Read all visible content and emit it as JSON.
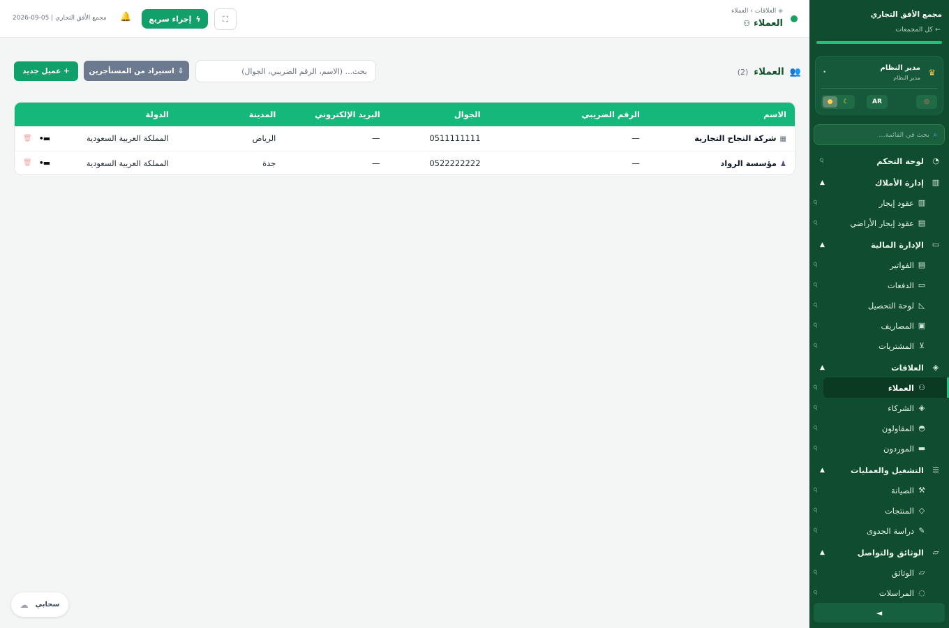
{
  "sidebar": {
    "brand_title": "مجمع الأفق التجاري",
    "brand_back": "← كل المجمعات",
    "user": {
      "name": "مدير النظام",
      "role": "مدير النظام",
      "dot": "•"
    },
    "lang_label": "AR",
    "search_placeholder": "بحث في القائمة...",
    "collapse_icon": "◄",
    "items": [
      {
        "label": "لوحة التحكم",
        "icon": "dashboard-icon",
        "glyph": "◔",
        "level": "top",
        "caret": ""
      },
      {
        "label": "إدارة الأملاك",
        "icon": "buildings-icon",
        "glyph": "▥",
        "level": "top",
        "caret": "▲"
      },
      {
        "label": "عقود إيجار",
        "icon": "building-icon",
        "glyph": "▥",
        "level": "sub",
        "caret": ""
      },
      {
        "label": "عقود إيجار الأراضي",
        "icon": "document-icon",
        "glyph": "▤",
        "level": "sub",
        "caret": ""
      },
      {
        "label": "الإدارة المالية",
        "icon": "wallet-icon",
        "glyph": "▭",
        "level": "top",
        "caret": "▲"
      },
      {
        "label": "الفواتير",
        "icon": "invoice-icon",
        "glyph": "▤",
        "level": "sub",
        "caret": ""
      },
      {
        "label": "الدفعات",
        "icon": "card-icon",
        "glyph": "▭",
        "level": "sub",
        "caret": ""
      },
      {
        "label": "لوحة التحصيل",
        "icon": "chart-icon",
        "glyph": "◺",
        "level": "sub",
        "caret": ""
      },
      {
        "label": "المصاريف",
        "icon": "cash-icon",
        "glyph": "▣",
        "level": "sub",
        "caret": ""
      },
      {
        "label": "المشتريات",
        "icon": "cart-icon",
        "glyph": "⊻",
        "level": "sub",
        "caret": ""
      },
      {
        "label": "العلاقات",
        "icon": "handshake-icon",
        "glyph": "◈",
        "level": "top",
        "caret": "▲"
      },
      {
        "label": "العملاء",
        "icon": "users-icon",
        "glyph": "⚇",
        "level": "sub",
        "caret": "",
        "active": true
      },
      {
        "label": "الشركاء",
        "icon": "handshake-icon",
        "glyph": "◈",
        "level": "sub",
        "caret": ""
      },
      {
        "label": "المقاولون",
        "icon": "helmet-icon",
        "glyph": "◓",
        "level": "sub",
        "caret": ""
      },
      {
        "label": "الموردون",
        "icon": "truck-icon",
        "glyph": "▬",
        "level": "sub",
        "caret": ""
      },
      {
        "label": "التشغيل والعمليات",
        "icon": "sliders-icon",
        "glyph": "☰",
        "level": "top",
        "caret": "▲"
      },
      {
        "label": "الصيانة",
        "icon": "wrench-icon",
        "glyph": "⚒",
        "level": "sub",
        "caret": ""
      },
      {
        "label": "المنتجات",
        "icon": "tag-icon",
        "glyph": "◇",
        "level": "sub",
        "caret": ""
      },
      {
        "label": "دراسة الجدوى",
        "icon": "pencil-icon",
        "glyph": "✎",
        "level": "sub",
        "caret": ""
      },
      {
        "label": "الوثائق والتواصل",
        "icon": "folder-icon",
        "glyph": "▱",
        "level": "top",
        "caret": "▲"
      },
      {
        "label": "الوثائق",
        "icon": "folder-icon",
        "glyph": "▱",
        "level": "sub",
        "caret": ""
      },
      {
        "label": "المراسلات",
        "icon": "chat-icon",
        "glyph": "◌",
        "level": "sub",
        "caret": ""
      }
    ]
  },
  "topbar": {
    "breadcrumb": "العلاقات › العملاء",
    "title": "العملاء",
    "quick_action": "إجراء سريع",
    "date_org": "2026-09-05 | مجمع الأفق التجاري"
  },
  "main": {
    "section_title": "العملاء",
    "count": "(2)",
    "search_placeholder": "بحث... (الاسم، الرقم الضريبي، الجوال)",
    "import_label": "استيراد من المستأجرين",
    "new_label": "+ عميل جديد",
    "columns": [
      "الاسم",
      "الرقم الضريبي",
      "الجوال",
      "البريد الإلكتروني",
      "المدينة",
      "الدولة"
    ],
    "rows": [
      {
        "name": "شركة النجاح التجارية",
        "type": "company",
        "tax": "—",
        "phone": "0511111111",
        "email": "—",
        "city": "الرياض",
        "country": "المملكة العربية السعودية"
      },
      {
        "name": "مؤسسة الرواد",
        "type": "person",
        "tax": "—",
        "phone": "0522222222",
        "email": "—",
        "city": "جدة",
        "country": "المملكة العربية السعودية"
      }
    ]
  },
  "cloud": {
    "label": "سحابي"
  }
}
